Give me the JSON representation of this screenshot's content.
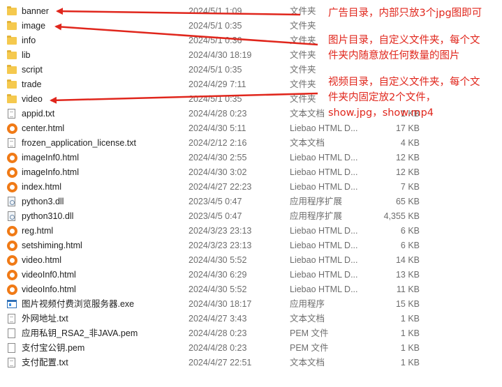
{
  "files": [
    {
      "name": "banner",
      "date": "2024/5/1 1:09",
      "type": "文件夹",
      "size": "",
      "icon": "folder-icon"
    },
    {
      "name": "image",
      "date": "2024/5/1 0:35",
      "type": "文件夹",
      "size": "",
      "icon": "folder-icon"
    },
    {
      "name": "info",
      "date": "2024/5/1 0:36",
      "type": "文件夹",
      "size": "",
      "icon": "folder-icon"
    },
    {
      "name": "lib",
      "date": "2024/4/30 18:19",
      "type": "文件夹",
      "size": "",
      "icon": "folder-icon"
    },
    {
      "name": "script",
      "date": "2024/5/1 0:35",
      "type": "文件夹",
      "size": "",
      "icon": "folder-icon"
    },
    {
      "name": "trade",
      "date": "2024/4/29 7:11",
      "type": "文件夹",
      "size": "",
      "icon": "folder-icon"
    },
    {
      "name": "video",
      "date": "2024/5/1 0:35",
      "type": "文件夹",
      "size": "",
      "icon": "folder-icon"
    },
    {
      "name": "appid.txt",
      "date": "2024/4/28 0:23",
      "type": "文本文档",
      "size": "1 KB",
      "icon": "text-file-icon"
    },
    {
      "name": "center.html",
      "date": "2024/4/30 5:11",
      "type": "Liebao HTML D...",
      "size": "17 KB",
      "icon": "browser-html-icon"
    },
    {
      "name": "frozen_application_license.txt",
      "date": "2024/2/12 2:16",
      "type": "文本文档",
      "size": "4 KB",
      "icon": "text-file-icon"
    },
    {
      "name": "imageInf0.html",
      "date": "2024/4/30 2:55",
      "type": "Liebao HTML D...",
      "size": "12 KB",
      "icon": "browser-html-icon"
    },
    {
      "name": "imageInfo.html",
      "date": "2024/4/30 3:02",
      "type": "Liebao HTML D...",
      "size": "12 KB",
      "icon": "browser-html-icon"
    },
    {
      "name": "index.html",
      "date": "2024/4/27 22:23",
      "type": "Liebao HTML D...",
      "size": "7 KB",
      "icon": "browser-html-icon"
    },
    {
      "name": "python3.dll",
      "date": "2023/4/5 0:47",
      "type": "应用程序扩展",
      "size": "65 KB",
      "icon": "dll-icon"
    },
    {
      "name": "python310.dll",
      "date": "2023/4/5 0:47",
      "type": "应用程序扩展",
      "size": "4,355 KB",
      "icon": "dll-icon"
    },
    {
      "name": "reg.html",
      "date": "2024/3/23 23:13",
      "type": "Liebao HTML D...",
      "size": "6 KB",
      "icon": "browser-html-icon"
    },
    {
      "name": "setshiming.html",
      "date": "2024/3/23 23:13",
      "type": "Liebao HTML D...",
      "size": "6 KB",
      "icon": "browser-html-icon"
    },
    {
      "name": "video.html",
      "date": "2024/4/30 5:52",
      "type": "Liebao HTML D...",
      "size": "14 KB",
      "icon": "browser-html-icon"
    },
    {
      "name": "videoInf0.html",
      "date": "2024/4/30 6:29",
      "type": "Liebao HTML D...",
      "size": "13 KB",
      "icon": "browser-html-icon"
    },
    {
      "name": "videoInfo.html",
      "date": "2024/4/30 5:52",
      "type": "Liebao HTML D...",
      "size": "11 KB",
      "icon": "browser-html-icon"
    },
    {
      "name": "图片视频付费浏览服务器.exe",
      "date": "2024/4/30 18:17",
      "type": "应用程序",
      "size": "15 KB",
      "icon": "exe-app-icon"
    },
    {
      "name": "外网地址.txt",
      "date": "2024/4/27 3:43",
      "type": "文本文档",
      "size": "1 KB",
      "icon": "text-file-icon"
    },
    {
      "name": "应用私钥_RSA2_非JAVA.pem",
      "date": "2024/4/28 0:23",
      "type": "PEM 文件",
      "size": "1 KB",
      "icon": "pem-file-icon"
    },
    {
      "name": "支付宝公钥.pem",
      "date": "2024/4/28 0:23",
      "type": "PEM 文件",
      "size": "1 KB",
      "icon": "pem-file-icon"
    },
    {
      "name": "支付配置.txt",
      "date": "2024/4/27 22:51",
      "type": "文本文档",
      "size": "1 KB",
      "icon": "text-file-icon"
    }
  ],
  "annotations": {
    "banner_note": "广告目录，内部只放3个jpg图即可",
    "image_note_line1": "图片目录，自定义文件夹，每个文",
    "image_note_line2": "件夹内随意放任何数量的图片",
    "video_note_line1": "视频目录，自定义文件夹，每个文",
    "video_note_line2": "件夹内固定放2个文件，",
    "video_note_line3": "show.jpg，show.mp4"
  },
  "colors": {
    "annotation": "#e0261c",
    "folder": "#f5c94e",
    "html_icon": "#f07a16",
    "secondary_text": "#6d6d6d"
  }
}
